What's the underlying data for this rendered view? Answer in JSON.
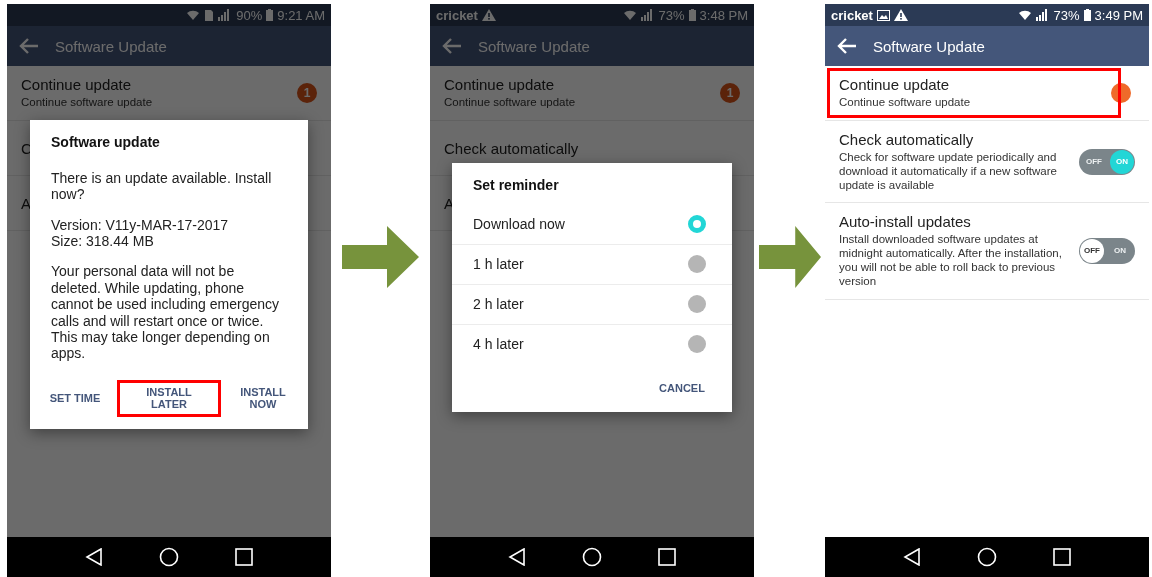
{
  "screens": [
    {
      "status_bar": {
        "icons": [
          {
            "kind": "wifi"
          },
          {
            "kind": "sim"
          },
          {
            "kind": "signal"
          }
        ],
        "battery": "90%",
        "time": "9:21 AM"
      },
      "app_bar": {
        "title": "Software Update"
      },
      "settings": [
        {
          "kind": "badge",
          "title": "Continue update",
          "subtitle": "Continue software update",
          "badge": "1",
          "highlighted": false
        },
        {
          "kind": "plain",
          "title": "C",
          "highlighted": false
        },
        {
          "kind": "plain",
          "title": "A",
          "highlighted": false
        }
      ],
      "dialog": {
        "kind": "message",
        "title": "Software update",
        "paragraphs": [
          "There is an update available. Install now?",
          "Version: V11y-MAR-17-2017\nSize: 318.44 MB",
          "Your personal data will not be deleted. While updating, phone cannot be used including emergency calls and will restart once or twice. This may take longer depending on apps."
        ],
        "buttons": [
          {
            "label": "SET TIME",
            "highlighted": false
          },
          {
            "label": "INSTALL LATER",
            "highlighted": true
          },
          {
            "label": "INSTALL NOW",
            "highlighted": false
          }
        ]
      }
    },
    {
      "status_bar": {
        "carrier": "cricket",
        "icons": [
          {
            "kind": "warning"
          },
          {
            "kind": "wifi"
          },
          {
            "kind": "signal"
          }
        ],
        "battery": "73%",
        "time": "3:48 PM"
      },
      "app_bar": {
        "title": "Software Update"
      },
      "settings": [
        {
          "kind": "badge",
          "title": "Continue update",
          "subtitle": "Continue software update",
          "badge": "1",
          "highlighted": false
        },
        {
          "kind": "plain",
          "title": "Check automatically",
          "highlighted": false
        },
        {
          "kind": "plain",
          "title": "A",
          "highlighted": false
        }
      ],
      "dialog": {
        "kind": "choice",
        "title": "Set reminder",
        "options": [
          {
            "label": "Download now",
            "selected": true
          },
          {
            "label": "1 h later",
            "selected": false
          },
          {
            "label": "2 h later",
            "selected": false
          },
          {
            "label": "4 h later",
            "selected": false
          }
        ],
        "buttons": [
          {
            "label": "CANCEL",
            "highlighted": false
          }
        ]
      }
    },
    {
      "status_bar": {
        "carrier": "cricket",
        "icons": [
          {
            "kind": "image"
          },
          {
            "kind": "warning"
          },
          {
            "kind": "wifi"
          },
          {
            "kind": "signal"
          }
        ],
        "battery": "73%",
        "time": "3:49 PM"
      },
      "app_bar": {
        "title": "Software Update"
      },
      "settings": [
        {
          "kind": "dot",
          "title": "Continue update",
          "subtitle": "Continue software update",
          "highlighted": true
        },
        {
          "kind": "toggle",
          "title": "Check automatically",
          "subtitle": "Check for software update periodically and download it automatically if a new software update is available",
          "on": true,
          "off_label": "OFF",
          "on_label": "ON",
          "highlighted": false
        },
        {
          "kind": "toggle",
          "title": "Auto-install updates",
          "subtitle": "Install downloaded software updates at midnight automatically. After the installation, you will not be able to roll back to previous version",
          "on": false,
          "off_label": "OFF",
          "on_label": "ON",
          "highlighted": false
        }
      ]
    }
  ]
}
